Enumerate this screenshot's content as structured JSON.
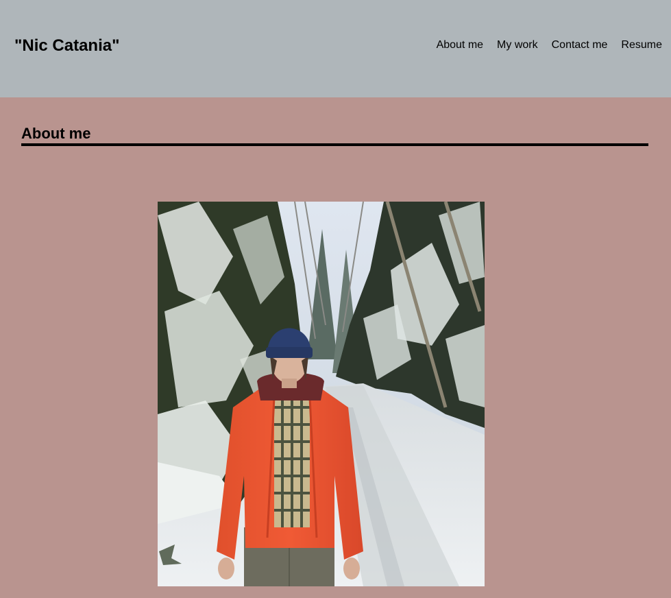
{
  "header": {
    "site_title": "\"Nic Catania\"",
    "nav": [
      {
        "label": "About me"
      },
      {
        "label": "My work"
      },
      {
        "label": "Contact me"
      },
      {
        "label": "Resume"
      }
    ]
  },
  "about": {
    "heading": "About me"
  },
  "colors": {
    "header_bg": "#afb6ba",
    "page_bg": "#b9948f",
    "text": "#000000"
  }
}
